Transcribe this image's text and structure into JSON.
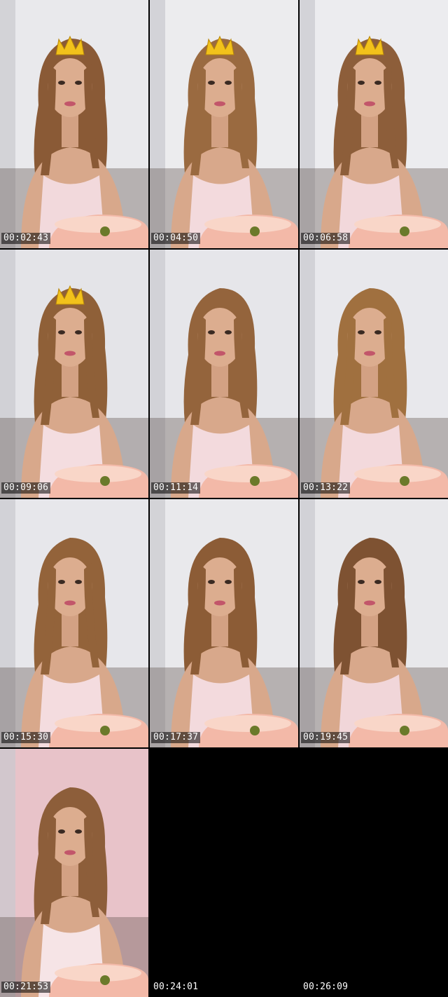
{
  "contact_sheet": {
    "frames": [
      {
        "timestamp": "00:02:43",
        "crown": true,
        "bg": "#e9e9ec",
        "hair": "#8a5a36",
        "top": "#f2d9dc",
        "bowl": true,
        "scene": true
      },
      {
        "timestamp": "00:04:50",
        "crown": true,
        "bg": "#ececee",
        "hair": "#9a6a40",
        "top": "#f3dadd",
        "bowl": true,
        "scene": true
      },
      {
        "timestamp": "00:06:58",
        "crown": true,
        "bg": "#ececef",
        "hair": "#8d5e3a",
        "top": "#f2d8db",
        "bowl": true,
        "scene": true
      },
      {
        "timestamp": "00:09:06",
        "crown": true,
        "bg": "#e4e4e8",
        "hair": "#8f6038",
        "top": "#f4dde0",
        "bowl": true,
        "scene": true
      },
      {
        "timestamp": "00:11:14",
        "crown": false,
        "bg": "#e6e6ea",
        "hair": "#94643c",
        "top": "#f3dadd",
        "bowl": true,
        "scene": true
      },
      {
        "timestamp": "00:13:22",
        "crown": false,
        "bg": "#e8e8ec",
        "hair": "#a0703f",
        "top": "#f3d9dc",
        "bowl": true,
        "scene": true
      },
      {
        "timestamp": "00:15:30",
        "crown": false,
        "bg": "#e7e7eb",
        "hair": "#93633a",
        "top": "#f4dcdf",
        "bowl": true,
        "scene": true
      },
      {
        "timestamp": "00:17:37",
        "crown": false,
        "bg": "#e9e9ec",
        "hair": "#8c5c36",
        "top": "#f3dadd",
        "bowl": true,
        "scene": true
      },
      {
        "timestamp": "00:19:45",
        "crown": false,
        "bg": "#e8e8eb",
        "hair": "#7e5232",
        "top": "#f1d6d9",
        "bowl": true,
        "scene": true
      },
      {
        "timestamp": "00:21:53",
        "crown": false,
        "bg": "#e8c3c9",
        "hair": "#8d5e3a",
        "top": "#f6e4e6",
        "bowl": true,
        "scene": true
      },
      {
        "timestamp": "00:24:01",
        "crown": false,
        "bg": "#000000",
        "hair": "#000000",
        "top": "#000000",
        "bowl": false,
        "scene": false
      },
      {
        "timestamp": "00:26:09",
        "crown": false,
        "bg": "#000000",
        "hair": "#000000",
        "top": "#000000",
        "bowl": false,
        "scene": false
      }
    ]
  }
}
